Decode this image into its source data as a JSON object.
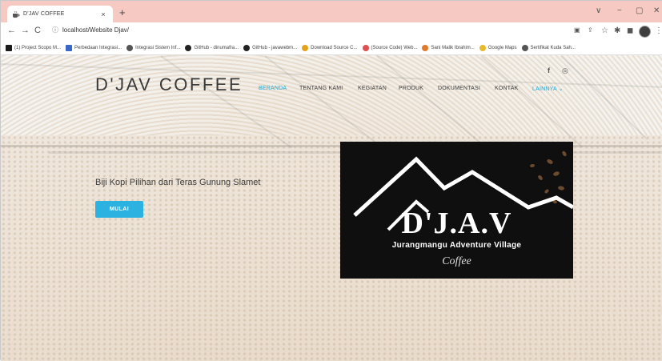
{
  "browser": {
    "tab_title": "D'JAV COFFEE",
    "tab_close": "×",
    "new_tab": "+",
    "url": "localhost/Website Djav/",
    "window_controls": [
      "∨",
      "−",
      "▢",
      "✕"
    ],
    "bookmarks": [
      {
        "label": "(1) Project Scopo M...",
        "icon": "bookmark-a-icon",
        "color": "#1b1b1b"
      },
      {
        "label": "Perbedaan Integrasi...",
        "icon": "bookmark-mail-icon",
        "color": "#3b68c4"
      },
      {
        "label": "Integrasi Sistem Inf...",
        "icon": "globe-icon",
        "color": "#555555"
      },
      {
        "label": "GitHub - dinumafra...",
        "icon": "github-icon",
        "color": "#222222"
      },
      {
        "label": "GitHub - javawebm...",
        "icon": "github-icon",
        "color": "#222222"
      },
      {
        "label": "Download Source C...",
        "icon": "download-icon",
        "color": "#e2a21b"
      },
      {
        "label": "(Source Code) Web...",
        "icon": "source-icon",
        "color": "#e05050"
      },
      {
        "label": "Sani Malik Ibrahim...",
        "icon": "heart-icon",
        "color": "#e07a2a"
      },
      {
        "label": "Google Maps",
        "icon": "maps-icon",
        "color": "#e9b82b"
      },
      {
        "label": "Sertifikat Kuda Sah...",
        "icon": "globe-icon",
        "color": "#555555"
      }
    ],
    "toolbar_icons": [
      "back-icon",
      "forward-icon",
      "reload-icon",
      "site-info-icon",
      "install-icon",
      "share-icon",
      "star-icon",
      "extensions-icon",
      "sidepanel-icon",
      "profile-icon",
      "more-icon"
    ]
  },
  "site": {
    "brand": "D'JAV COFFEE",
    "menu": [
      {
        "label": "BERANDA",
        "active": true
      },
      {
        "label": "TENTANG KAMI",
        "active": false
      },
      {
        "label": "KEGIATAN",
        "active": false
      },
      {
        "label": "PRODUK",
        "active": false
      },
      {
        "label": "DOKUMENTASI",
        "active": false
      },
      {
        "label": "KONTAK",
        "active": false
      },
      {
        "label": "LAINNYA ⌄",
        "active": true
      }
    ],
    "social": {
      "facebook": "f",
      "instagram": "◎"
    },
    "hero_text": "Biji Kopi Pilihan dari Teras Gunung Slamet",
    "cta": "MULAI",
    "logo": {
      "mark": "D'J.A.V",
      "subtitle": "Jurangmangu Adventure Village",
      "script": "Coffee"
    },
    "accent_color": "#23a7d6"
  }
}
